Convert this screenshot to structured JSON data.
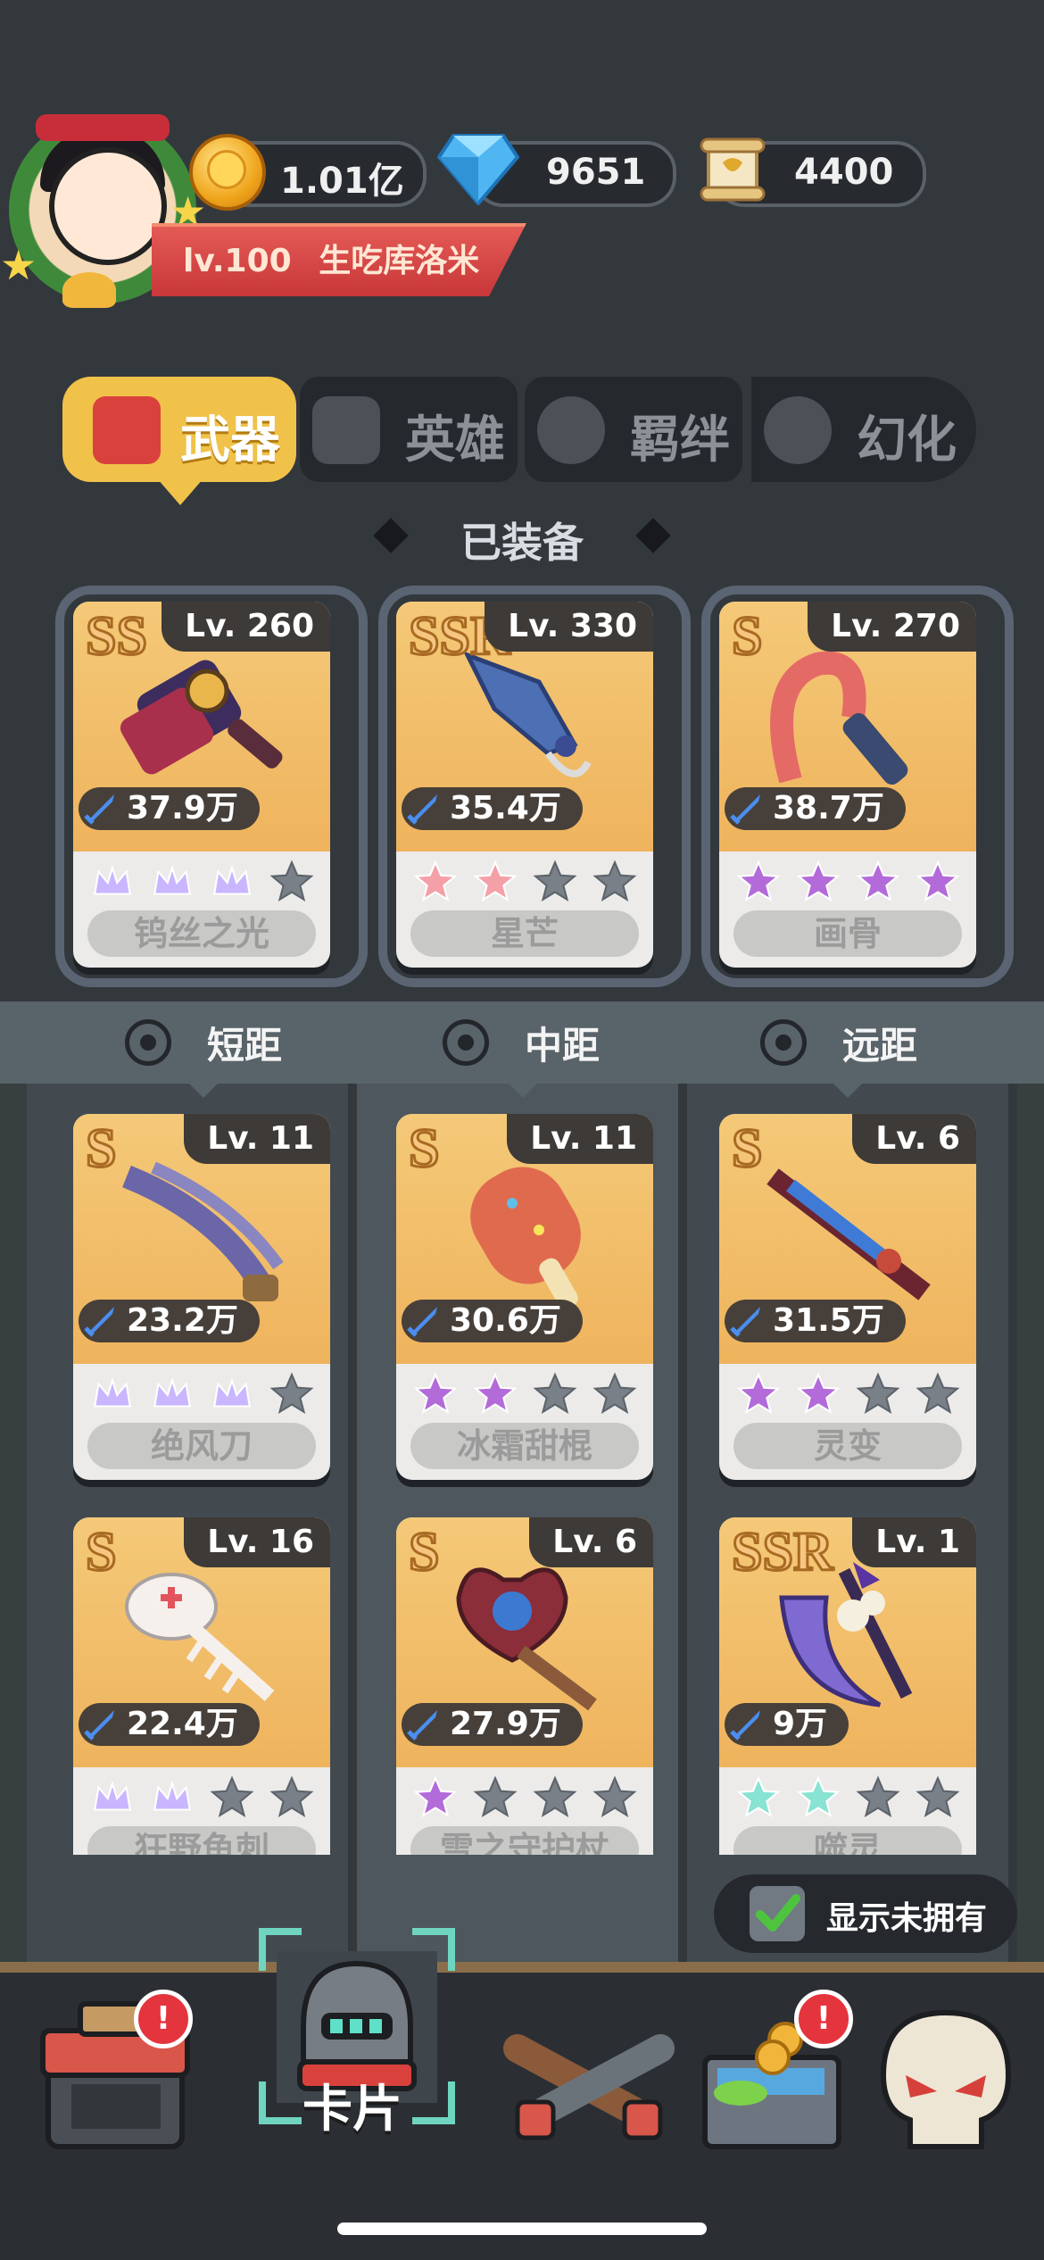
{
  "header": {
    "level": "lv.100",
    "player_name": "生吃库洛米",
    "resources": [
      {
        "name": "coin-icon",
        "value": "1.01亿"
      },
      {
        "name": "diamond-icon",
        "value": "9651"
      },
      {
        "name": "scroll-icon",
        "value": "4400"
      }
    ]
  },
  "tabs": [
    {
      "label": "武器",
      "active": true,
      "icon": "weapon-tab-icon"
    },
    {
      "label": "英雄",
      "active": false,
      "icon": "hero-tab-icon"
    },
    {
      "label": "羁绊",
      "active": false,
      "icon": "bond-tab-icon"
    },
    {
      "label": "幻化",
      "active": false,
      "icon": "transform-tab-icon"
    }
  ],
  "equipped_title": "已装备",
  "equipped": [
    {
      "grade": "SS",
      "level": "Lv. 260",
      "power": "37.9万",
      "name": "钨丝之光",
      "stars": [
        "crown",
        "crown",
        "crown",
        "empty"
      ]
    },
    {
      "grade": "SSR",
      "level": "Lv. 330",
      "power": "35.4万",
      "name": "星芒",
      "stars": [
        "pink",
        "pink",
        "empty",
        "empty"
      ]
    },
    {
      "grade": "S",
      "level": "Lv. 270",
      "power": "38.7万",
      "name": "画骨",
      "stars": [
        "purple",
        "purple",
        "purple",
        "purple"
      ]
    }
  ],
  "ranges": [
    "短距",
    "中距",
    "远距"
  ],
  "weapons": [
    {
      "grade": "S",
      "level": "Lv. 11",
      "power": "23.2万",
      "name": "绝风刀",
      "stars": [
        "crown",
        "crown",
        "crown",
        "empty"
      ]
    },
    {
      "grade": "S",
      "level": "Lv. 11",
      "power": "30.6万",
      "name": "冰霜甜棍",
      "stars": [
        "purple",
        "purple",
        "empty",
        "empty"
      ]
    },
    {
      "grade": "S",
      "level": "Lv. 6",
      "power": "31.5万",
      "name": "灵变",
      "stars": [
        "purple",
        "purple",
        "empty",
        "empty"
      ]
    },
    {
      "grade": "S",
      "level": "Lv. 16",
      "power": "22.4万",
      "name": "狂野鱼刺",
      "stars": [
        "crown",
        "crown",
        "empty",
        "empty"
      ]
    },
    {
      "grade": "S",
      "level": "Lv. 6",
      "power": "27.9万",
      "name": "雪之守护杖",
      "stars": [
        "purple",
        "empty",
        "empty",
        "empty"
      ]
    },
    {
      "grade": "SSR",
      "level": "Lv. 1",
      "power": "9万",
      "name": "噬灵",
      "stars": [
        "teal",
        "teal",
        "empty",
        "empty"
      ]
    }
  ],
  "toggle": {
    "label": "显示未拥有",
    "checked": true
  },
  "nav": {
    "items": [
      {
        "name": "shop",
        "badge": "!"
      },
      {
        "name": "cards",
        "label": "卡片",
        "active": true
      },
      {
        "name": "weapons-battle"
      },
      {
        "name": "treasure",
        "badge": "!"
      },
      {
        "name": "skull"
      }
    ]
  },
  "colors": {
    "accent": "#f1c24a",
    "banner": "#d9423c",
    "card_art": "#f2bf6c"
  }
}
